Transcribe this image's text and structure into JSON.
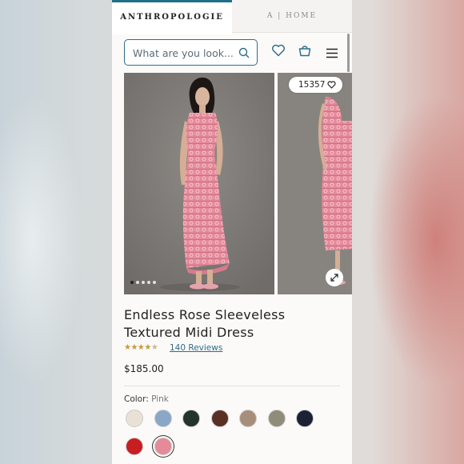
{
  "tabs": {
    "brand": "ANTHROPOLOGIE",
    "home": "A | HOME"
  },
  "search": {
    "placeholder": "What are you look..."
  },
  "header_icons": [
    "search-icon",
    "heart-icon",
    "bag-icon",
    "menu-icon"
  ],
  "gallery": {
    "likes_count": "15357",
    "images": 5,
    "active_image": 1
  },
  "product": {
    "title": "Endless Rose Sleeveless Textured Midi Dress",
    "rating": 4.5,
    "rating_stars": "★★★★",
    "rating_half_star": "★",
    "reviews_label": "140 Reviews",
    "price": "$185.00"
  },
  "color": {
    "label": "Color:",
    "selected": "Pink",
    "swatches": [
      {
        "name": "ivory",
        "hex": "#e9e1d6"
      },
      {
        "name": "blue",
        "hex": "#8aa7c7"
      },
      {
        "name": "dark green",
        "hex": "#23332e"
      },
      {
        "name": "brown",
        "hex": "#5a3025"
      },
      {
        "name": "taupe",
        "hex": "#a78e7a"
      },
      {
        "name": "sage",
        "hex": "#8f8d7a"
      },
      {
        "name": "navy",
        "hex": "#1d2135"
      },
      {
        "name": "red",
        "hex": "#c81d21"
      },
      {
        "name": "pink",
        "hex": "#e58a98",
        "selected": true
      }
    ]
  },
  "colors": {
    "accent": "#2d6e8c",
    "tab_underline": "#1f6f8b",
    "star": "#c89a3a",
    "dress_pink": "#e3899a"
  }
}
